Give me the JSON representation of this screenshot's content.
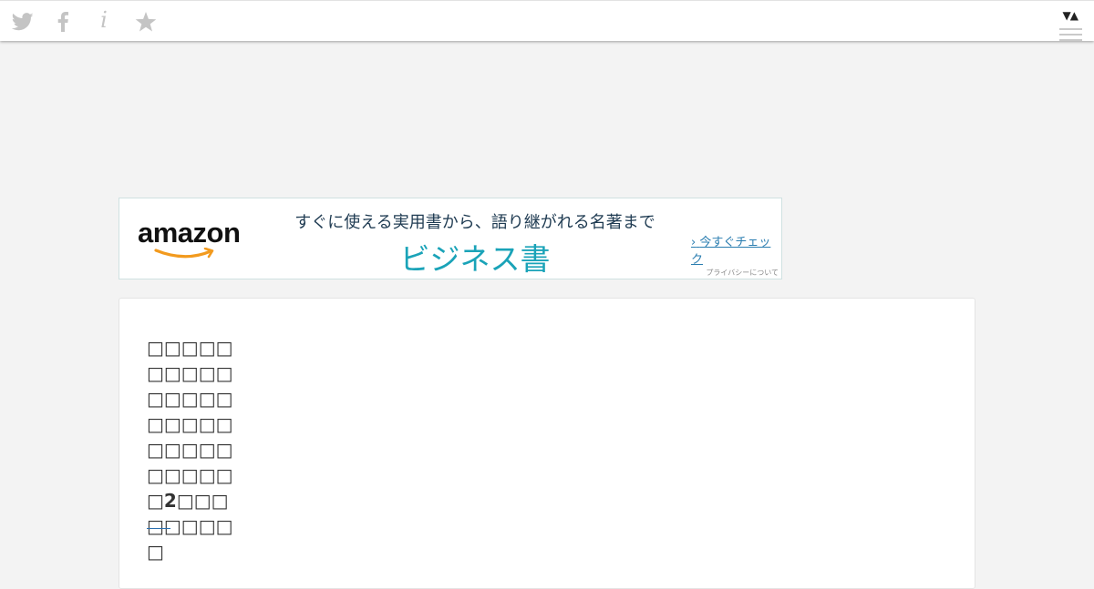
{
  "toolbar": {
    "icons": [
      "twitter-icon",
      "facebook-icon",
      "info-icon",
      "star-icon"
    ],
    "info_glyph": "i",
    "scroll_arrows": "▼▲"
  },
  "ad": {
    "logo_text": "amazon",
    "tagline": "すぐに使える実用書から、語り継がれる名著まで",
    "headline": "ビジネス書",
    "cta": "今すぐチェック",
    "privacy": "プライバシーについて",
    "colors": {
      "headline": "#1aa3b8",
      "tagline": "#1f3b52",
      "smile": "#f29a1e",
      "cta": "#2a7db0"
    }
  },
  "article": {
    "title": "□□□□□□□□□□□□□□□□□□□□□□□□□□□□□□□2□□□□□□□□□"
  },
  "colors": {
    "page_background": "#f3f3f3",
    "icon_gray": "#c4c4c4",
    "accent_rule": "#2a6fb0"
  }
}
